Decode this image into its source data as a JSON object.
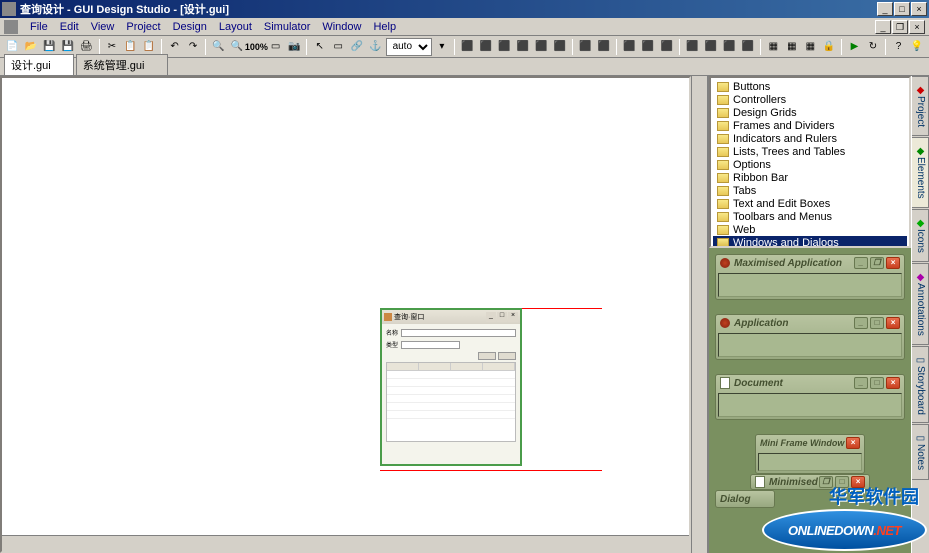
{
  "title": "查询设计 - GUI Design Studio - [设计.gui]",
  "menu": {
    "items": [
      "File",
      "Edit",
      "View",
      "Project",
      "Design",
      "Layout",
      "Simulator",
      "Window",
      "Help"
    ]
  },
  "toolbar": {
    "zoom_label": "100%",
    "combo_value": "auto"
  },
  "tabs": {
    "items": [
      "设计.gui",
      "系统管理.gui"
    ]
  },
  "tree": {
    "items": [
      "Buttons",
      "Controllers",
      "Design Grids",
      "Frames and Dividers",
      "Indicators and Rulers",
      "Lists, Trees and Tables",
      "Options",
      "Ribbon Bar",
      "Tabs",
      "Text and Edit Boxes",
      "Toolbars and Menus",
      "Web",
      "Windows and Dialogs"
    ],
    "selected": 12
  },
  "side_tabs": {
    "items": [
      "Project",
      "Elements",
      "Icons",
      "Annotations",
      "Storyboard",
      "Notes"
    ],
    "active": 1
  },
  "previews": {
    "items": [
      {
        "label": "Maximised Application",
        "type": "app-max"
      },
      {
        "label": "Application",
        "type": "app"
      },
      {
        "label": "Document",
        "type": "doc"
      },
      {
        "label": "Mini Frame Window",
        "type": "mini"
      },
      {
        "label": "Minimised",
        "type": "minimised"
      },
      {
        "label": "Dialog",
        "type": "dialog"
      }
    ]
  },
  "watermark": {
    "chinese": "华军软件园",
    "english": "ONLINEDOWN",
    "suffix": ".NET"
  }
}
